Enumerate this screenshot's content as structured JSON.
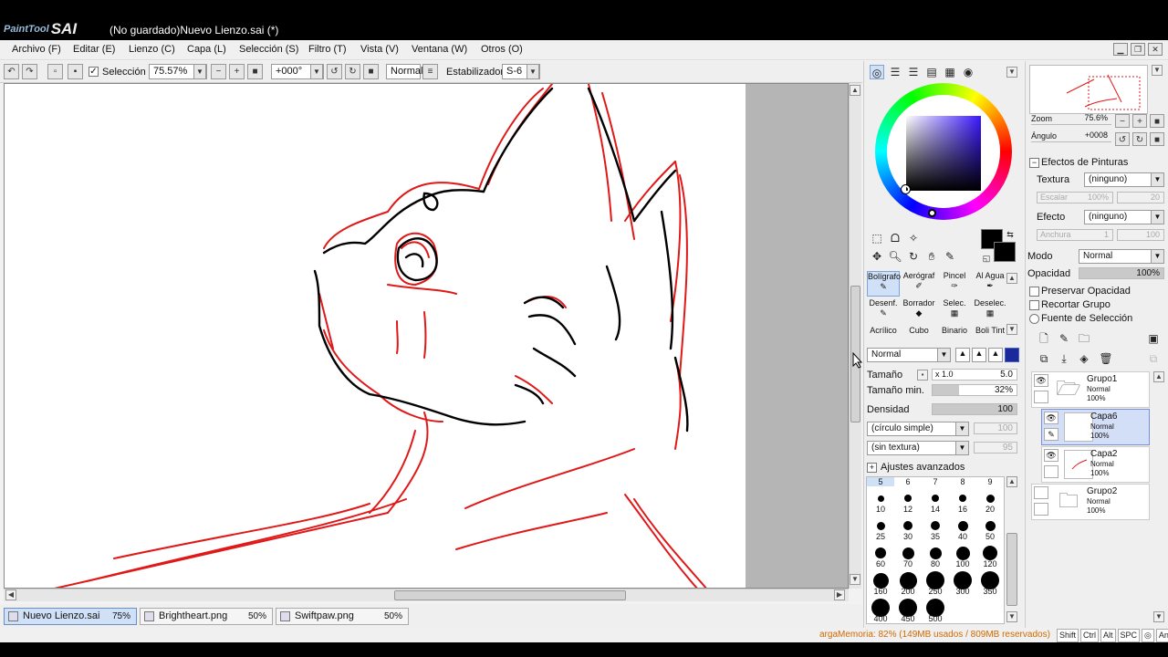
{
  "app": {
    "logo_text": "PaintTool",
    "logo_brand": "SAI",
    "window_title": "(No guardado)Nuevo Lienzo.sai (*)"
  },
  "menu": [
    "Archivo (F)",
    "Editar (E)",
    "Lienzo (C)",
    "Capa (L)",
    "Selección (S)",
    "Filtro (T)",
    "Vista (V)",
    "Ventana (W)",
    "Otros (O)"
  ],
  "toolbar": {
    "selection_label": "Selección",
    "zoom": "75.57%",
    "angle": "+000°",
    "mode": "Normal",
    "stabilizer_label": "Estabilizador",
    "stabilizer_value": "S-6"
  },
  "tabs": [
    {
      "name": "Nuevo Lienzo.sai",
      "zoom": "75%",
      "active": true
    },
    {
      "name": "Brightheart.png",
      "zoom": "50%",
      "active": false
    },
    {
      "name": "Swiftpaw.png",
      "zoom": "50%",
      "active": false
    }
  ],
  "status": {
    "memory": "argaMemoria: 82% (149MB usados / 809MB reservados)",
    "modifiers": [
      "Shift",
      "Ctrl",
      "Alt",
      "SPC",
      "◎",
      "Any"
    ]
  },
  "tools": [
    {
      "label": "Bolígrafo",
      "selected": true
    },
    {
      "label": "Aerógraf",
      "selected": false
    },
    {
      "label": "Pincel",
      "selected": false
    },
    {
      "label": "Al Agua",
      "selected": false
    },
    {
      "label": "Desenf.",
      "selected": false
    },
    {
      "label": "Borrador",
      "selected": false
    },
    {
      "label": "Selec.",
      "selected": false
    },
    {
      "label": "Deselec.",
      "selected": false
    },
    {
      "label": "Acrílico",
      "selected": false
    },
    {
      "label": "Cubo",
      "selected": false
    },
    {
      "label": "Binario",
      "selected": false
    },
    {
      "label": "Boli Tint",
      "selected": false
    }
  ],
  "brush": {
    "blend_mode": "Normal",
    "size_label": "Tamaño",
    "size_mult": "x 1.0",
    "size_value": "5.0",
    "min_size_label": "Tamaño min.",
    "min_size_value": "32%",
    "min_size_fraction": 0.32,
    "density_label": "Densidad",
    "density_value": "100",
    "shape": "(círculo simple)",
    "shape_value": "100",
    "texture": "(sin textura)",
    "texture_value": "95",
    "advanced_label": "Ajustes avanzados"
  },
  "brush_sizes": [
    {
      "label": "5",
      "top": true
    },
    {
      "label": "6",
      "top": true
    },
    {
      "label": "7",
      "top": true
    },
    {
      "label": "8",
      "top": true
    },
    {
      "label": "9",
      "top": true
    },
    {
      "label": "10"
    },
    {
      "label": "12"
    },
    {
      "label": "14"
    },
    {
      "label": "16"
    },
    {
      "label": "20"
    },
    {
      "label": "25"
    },
    {
      "label": "30"
    },
    {
      "label": "35"
    },
    {
      "label": "40"
    },
    {
      "label": "50"
    },
    {
      "label": "60"
    },
    {
      "label": "70"
    },
    {
      "label": "80"
    },
    {
      "label": "100"
    },
    {
      "label": "120"
    },
    {
      "label": "160"
    },
    {
      "label": "200"
    },
    {
      "label": "250"
    },
    {
      "label": "300"
    },
    {
      "label": "350"
    },
    {
      "label": "400"
    },
    {
      "label": "450"
    },
    {
      "label": "500"
    }
  ],
  "navigator": {
    "zoom_label": "Zoom",
    "zoom_value": "75.6%",
    "angle_label": "Ángulo",
    "angle_value": "+0008"
  },
  "paint_effects": {
    "header": "Efectos de Pinturas",
    "texture_label": "Textura",
    "texture_value": "(ninguno)",
    "scale_label": "Escalar",
    "scale_value": "100%",
    "scale_num": "20",
    "effect_label": "Efecto",
    "effect_value": "(ninguno)",
    "width_label": "Anchura",
    "width_value": "1",
    "width_num": "100"
  },
  "layer_props": {
    "mode_label": "Modo",
    "mode_value": "Normal",
    "opacity_label": "Opacidad",
    "opacity_value": "100%",
    "preserve_opacity": "Preservar Opacidad",
    "clip_group": "Recortar Grupo",
    "selection_source": "Fuente de Selección"
  },
  "layers": [
    {
      "name": "Grupo1",
      "mode": "Normal",
      "opacity": "100%",
      "type": "group",
      "active": false
    },
    {
      "name": "Capa6",
      "mode": "Normal",
      "opacity": "100%",
      "type": "layer",
      "active": true
    },
    {
      "name": "Capa2",
      "mode": "Normal",
      "opacity": "100%",
      "type": "layer",
      "active": false
    },
    {
      "name": "Grupo2",
      "mode": "Normal",
      "opacity": "100%",
      "type": "group",
      "active": false
    }
  ],
  "colors": {
    "primary": "#000000",
    "secondary": "#000000",
    "sketch_red": "#e01818",
    "line_black": "#000000",
    "selection_blue": "#cfe0f7"
  }
}
